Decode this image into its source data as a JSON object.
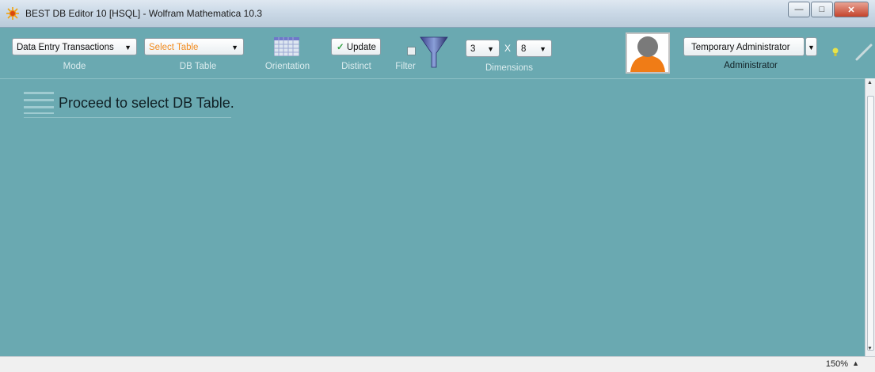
{
  "window": {
    "title": "BEST DB Editor 10 [HSQL] - Wolfram Mathematica 10.3",
    "minimize_glyph": "—",
    "maximize_glyph": "□",
    "close_glyph": "✕"
  },
  "toolbar": {
    "mode": {
      "value": "Data Entry Transactions",
      "label": "Mode"
    },
    "db_table": {
      "value": "Select Table",
      "label": "DB Table",
      "value_color": "#f28c1f"
    },
    "orientation": {
      "label": "Orientation"
    },
    "distinct": {
      "button_label": "Update",
      "check_glyph": "✓",
      "label": "Distinct"
    },
    "filter": {
      "label": "Filter"
    },
    "dimensions": {
      "rows": "3",
      "x_label": "X",
      "cols": "8",
      "label": "Dimensions"
    },
    "user": {
      "name": "Temporary Administrator",
      "role": "Administrator"
    }
  },
  "main": {
    "message": "Proceed to select DB Table."
  },
  "statusbar": {
    "zoom": "150%"
  },
  "colors": {
    "background": "#6aa9b1",
    "avatar_body": "#f07c16",
    "avatar_head": "#7a7a7a"
  }
}
